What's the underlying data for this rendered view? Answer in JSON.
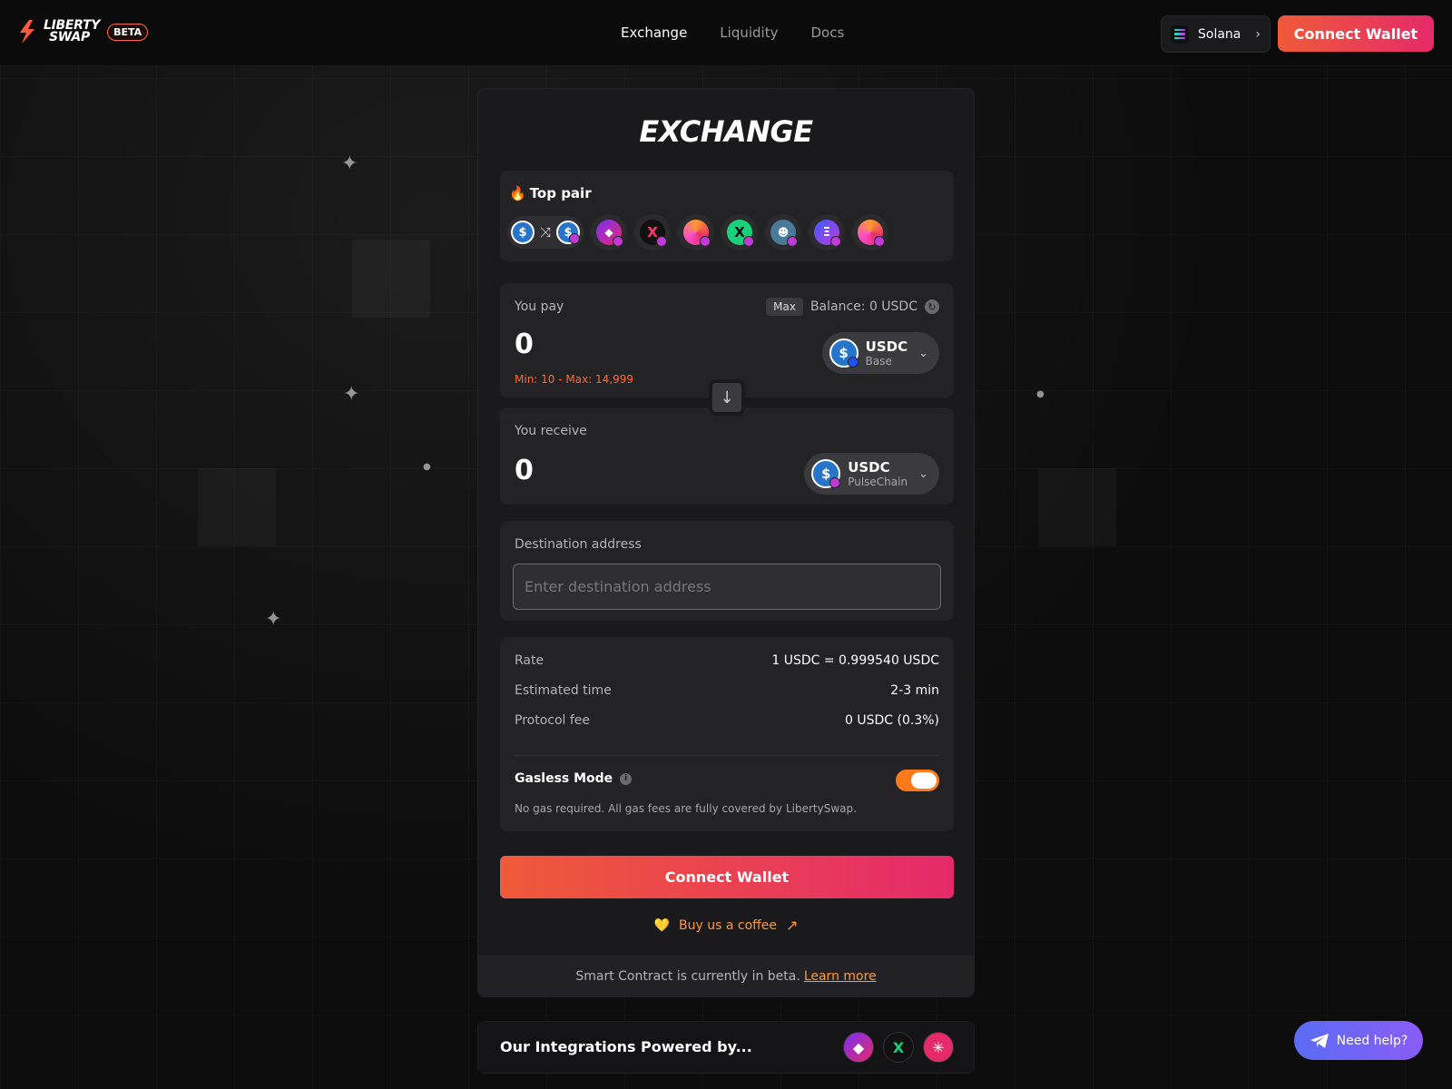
{
  "header": {
    "logo_line1": "LIBERTY",
    "logo_line2": "SWAP",
    "beta": "BETA",
    "nav": [
      "Exchange",
      "Liquidity",
      "Docs"
    ],
    "active_nav": "Exchange",
    "chain": "Solana",
    "connect_label": "Connect Wallet"
  },
  "exchange": {
    "title": "EXCHANGE",
    "top_pair": {
      "label": "Top pair",
      "icons": [
        "fire-icon",
        "usdc-icon",
        "shuffle-icon",
        "usdc-icon",
        "pulsex-icon",
        "x-token-icon",
        "hex-token-icon",
        "x-token-green-icon",
        "pepe-token-icon",
        "stablecoin-icon",
        "hex-token-icon"
      ]
    },
    "pay": {
      "label": "You pay",
      "max_label": "Max",
      "balance": "Balance: 0 USDC",
      "amount": "0",
      "limits": "Min: 10 - Max: 14,999",
      "token": {
        "symbol": "USDC",
        "network": "Base"
      }
    },
    "receive": {
      "label": "You receive",
      "amount": "0",
      "token": {
        "symbol": "USDC",
        "network": "PulseChain"
      }
    },
    "destination": {
      "label": "Destination address",
      "placeholder": "Enter destination address",
      "value": ""
    },
    "details": {
      "rate_label": "Rate",
      "rate_value": "1 USDC = 0.999540 USDC",
      "time_label": "Estimated time",
      "time_value": "2-3 min",
      "fee_label": "Protocol fee",
      "fee_value": "0 USDC (0.3%)",
      "gasless_label": "Gasless Mode",
      "gasless_enabled": true,
      "gasless_note": "No gas required. All gas fees are fully covered by LibertySwap."
    },
    "connect_label": "Connect Wallet",
    "coffee_label": "Buy us a coffee",
    "beta_note": "Smart Contract is currently in beta.",
    "learn_more": "Learn more"
  },
  "integrations": {
    "title": "Our Integrations Powered by...",
    "icons": [
      "pulsex-icon",
      "x-token-icon",
      "asterisk-icon"
    ]
  },
  "help_label": "Need help?",
  "colors": {
    "accent_start": "#ef5a39",
    "accent_end": "#e52a6a",
    "warning": "#ff6a2c",
    "coffee": "#ff9a2e",
    "toggle_on": "#ff7a1a"
  }
}
